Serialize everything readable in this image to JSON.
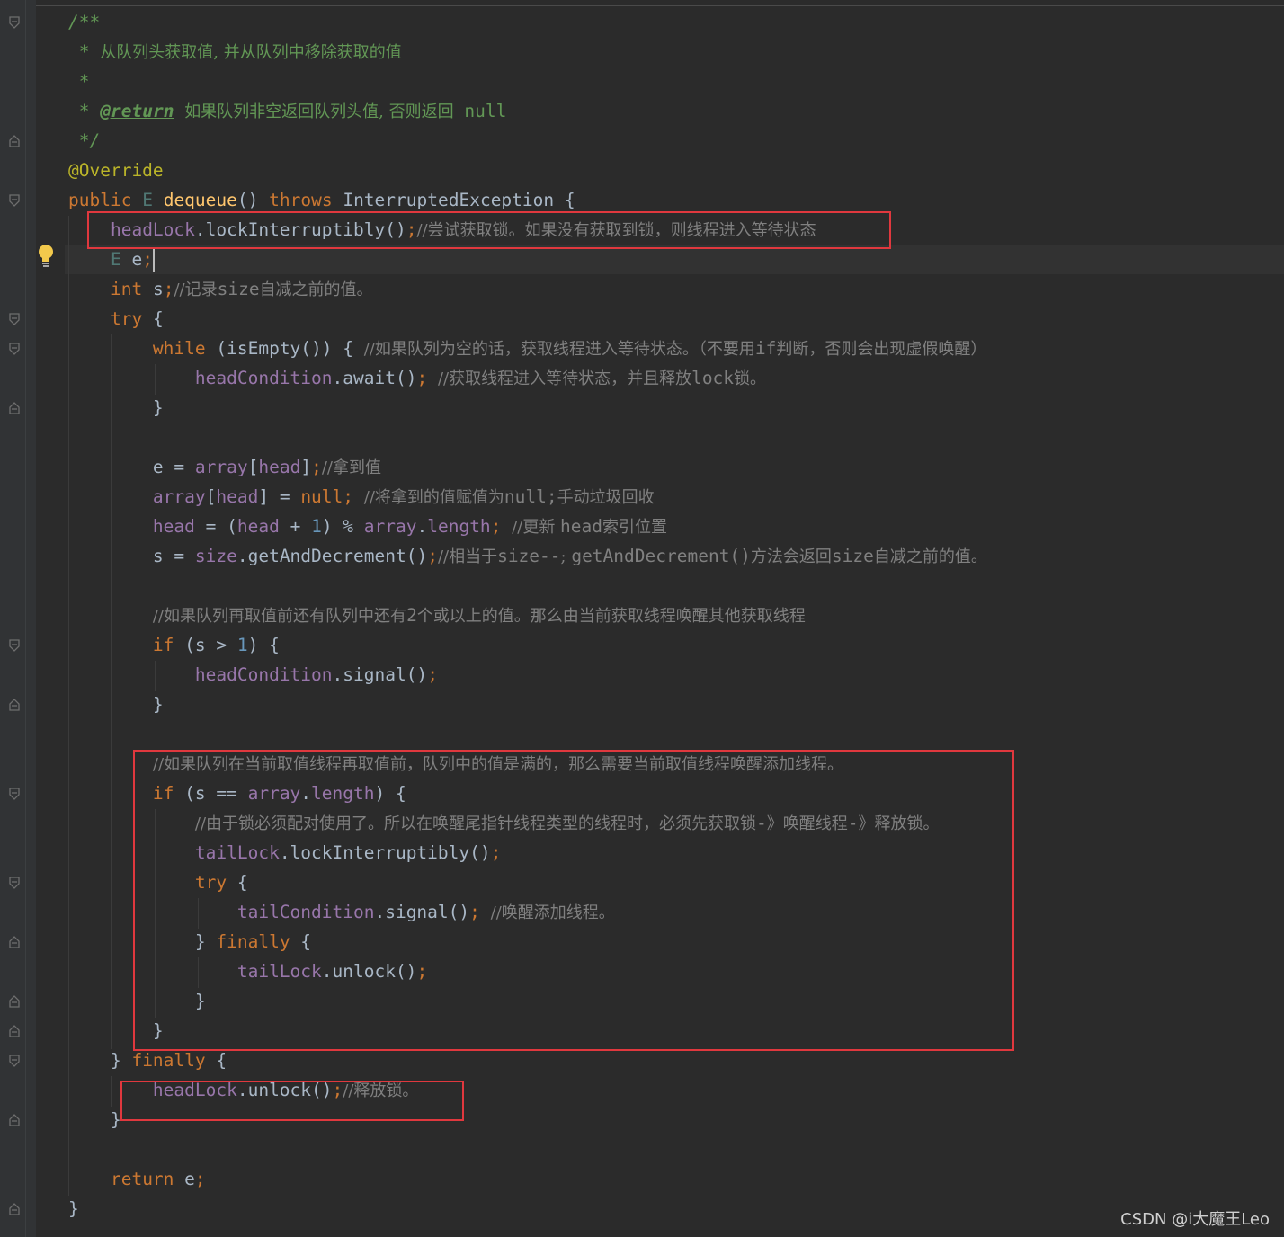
{
  "editor": {
    "lines": {
      "l1": "/**",
      "l2": "从队列头获取值, 并从队列中移除获取的值",
      "l3": "*",
      "l4_tag": "@return",
      "l4_text": "如果队列非空返回队列头值, 否则返回",
      "l4_null": "null",
      "l5": "*/",
      "l6": "@Override",
      "l7_public": "public",
      "l7_type": "E",
      "l7_method": "dequeue",
      "l7_throws": "throws",
      "l7_exc": "InterruptedException {",
      "l8_field": "headLock",
      "l8_call": ".lockInterruptibly()",
      "l8_comment": "//尝试获取锁。如果没有获取到锁，则线程进入等待状态",
      "l9_type": "E",
      "l9_var": "e",
      "l10_int": "int",
      "l10_var": "s",
      "l10_comment_a": "//记录",
      "l10_comment_b": "size",
      "l10_comment_c": "自减之前的值。",
      "l11": "try",
      "l12_while": "while",
      "l12_call": "(isEmpty()) {",
      "l12_comment_a": "//如果队列为空的话，获取线程进入等待状态。（不要用",
      "l12_comment_b": "if",
      "l12_comment_c": "判断，否则会出现虚假唤醒）",
      "l13_field": "headCondition",
      "l13_call": ".await()",
      "l13_comment_a": "//获取线程进入等待状态，并且释放",
      "l13_comment_b": "lock",
      "l13_comment_c": "锁。",
      "l14": "}",
      "l16_a": "e = ",
      "l16_f1": "array",
      "l16_b": "[",
      "l16_f2": "head",
      "l16_c": "]",
      "l16_comment": "//拿到值",
      "l17_f1": "array",
      "l17_a": "[",
      "l17_f2": "head",
      "l17_b": "] = ",
      "l17_null": "null",
      "l17_comment_a": "//将拿到的值赋值为",
      "l17_comment_b": "null;",
      "l17_comment_c": "手动垃圾回收",
      "l18_f1": "head",
      "l18_a": " = (",
      "l18_f2": "head",
      "l18_b": " + ",
      "l18_num": "1",
      "l18_c": ") % ",
      "l18_f3": "array",
      "l18_d": ".",
      "l18_f4": "length",
      "l18_comment_a": "//更新 ",
      "l18_comment_b": "head",
      "l18_comment_c": "索引位置",
      "l19_a": "s = ",
      "l19_f1": "size",
      "l19_b": ".getAndDecrement()",
      "l19_comment_a": "//相当于",
      "l19_comment_b": "size--",
      "l19_comment_c": "; ",
      "l19_comment_d": "getAndDecrement()",
      "l19_comment_e": "方法会返回",
      "l19_comment_f": "size",
      "l19_comment_g": "自减之前的值。",
      "l21_comment_a": "//如果队列再取值前还有队列中还有",
      "l21_comment_b": "2",
      "l21_comment_c": "个或以上的值。那么由当前获取线程唤醒其他获取线程",
      "l22_if": "if",
      "l22_a": " (s > ",
      "l22_num": "1",
      "l22_b": ") {",
      "l23_field": "headCondition",
      "l23_call": ".signal()",
      "l24": "}",
      "l26_comment": "//如果队列在当前取值线程再取值前，队列中的值是满的，那么需要当前取值线程唤醒添加线程。",
      "l27_if": "if",
      "l27_a": " (s == ",
      "l27_f1": "array",
      "l27_b": ".",
      "l27_f2": "length",
      "l27_c": ") {",
      "l28_comment_a": "//由于锁必须配对使用了。所以在唤醒尾指针线程类型的线程时，必须先获取锁",
      "l28_comment_b": "-",
      "l28_comment_c": "》唤醒线程",
      "l28_comment_d": "-",
      "l28_comment_e": "》释放锁。",
      "l29_field": "tailLock",
      "l29_call": ".lockInterruptibly()",
      "l30_try": "try",
      "l30_brace": " {",
      "l31_field": "tailCondition",
      "l31_call": ".signal()",
      "l31_comment": "//唤醒添加线程。",
      "l32_close": "} ",
      "l32_finally": "finally",
      "l32_brace": " {",
      "l33_field": "tailLock",
      "l33_call": ".unlock()",
      "l34": "}",
      "l35": "}",
      "l36_close": "} ",
      "l36_finally": "finally",
      "l36_brace": " {",
      "l37_field": "headLock",
      "l37_call": ".unlock()",
      "l37_comment": "//释放锁。",
      "l38": "}",
      "l40_return": "return",
      "l40_var": " e",
      "l41": "}"
    },
    "semicolon": ";",
    "brace_open": " {",
    "doc_star": "*",
    "parens": "()"
  },
  "watermark": "CSDN @i大魔王Leo",
  "colors": {
    "background": "#2b2b2b",
    "keyword": "#cc7832",
    "field": "#9876aa",
    "comment": "#808080",
    "doc_comment": "#629755",
    "method": "#ffc66d",
    "annotation": "#bbb529",
    "number": "#6897bb",
    "highlight_box": "#e0383e"
  },
  "icons": [
    "fold-marker-icon",
    "lightbulb-icon"
  ]
}
